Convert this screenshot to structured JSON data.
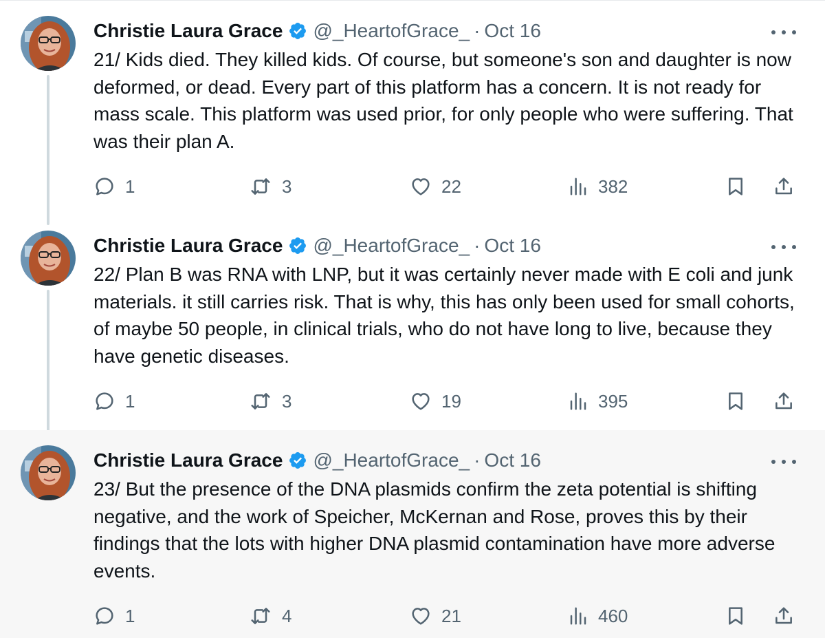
{
  "tweets": [
    {
      "author_name": "Christie Laura Grace",
      "handle": "@_HeartofGrace_",
      "separator": "·",
      "date": "Oct 16",
      "text": "21/ Kids died. They killed kids. Of course, but someone's son and daughter is now deformed, or dead. Every part of this platform has a concern. It is not ready for mass scale. This platform was used prior, for only people who were suffering. That was their plan A.",
      "replies": "1",
      "retweets": "3",
      "likes": "22",
      "views": "382"
    },
    {
      "author_name": "Christie Laura Grace",
      "handle": "@_HeartofGrace_",
      "separator": "·",
      "date": "Oct 16",
      "text": "22/ Plan B was RNA with LNP, but it was certainly never made with E coli and junk materials. it still carries risk. That is why, this has only been used for small cohorts, of maybe 50 people, in clinical trials, who do not have long to live, because they have genetic diseases.",
      "replies": "1",
      "retweets": "3",
      "likes": "19",
      "views": "395"
    },
    {
      "author_name": "Christie Laura Grace",
      "handle": "@_HeartofGrace_",
      "separator": "·",
      "date": "Oct 16",
      "text": "23/ But the presence of the DNA plasmids confirm the zeta potential is shifting negative, and the work of Speicher, McKernan and Rose, proves this by their findings that the lots with higher DNA plasmid contamination have more adverse events.",
      "replies": "1",
      "retweets": "4",
      "likes": "21",
      "views": "460"
    }
  ],
  "icons": {
    "reply": "reply-icon",
    "retweet": "retweet-icon",
    "like": "heart-icon",
    "views": "views-chart-icon",
    "bookmark": "bookmark-icon",
    "share": "share-icon",
    "more": "more-dots-icon",
    "verified": "verified-badge-icon"
  },
  "colors": {
    "verified": "#1d9bf0",
    "muted_text": "#536471",
    "primary_text": "#0f1419",
    "thread_line": "#cfd9de",
    "highlight_bg": "#f7f7f7"
  }
}
